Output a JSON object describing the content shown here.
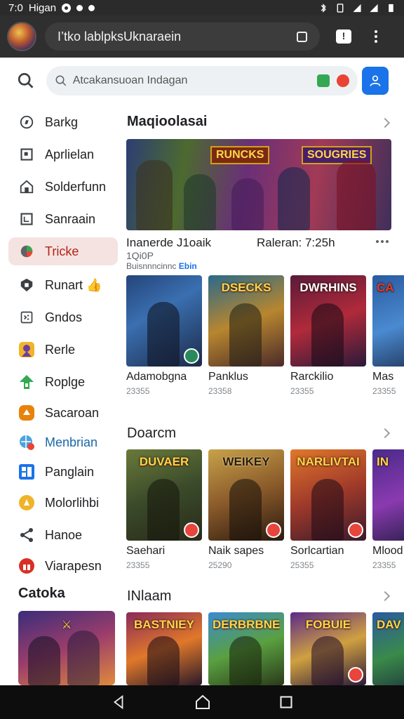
{
  "status": {
    "time": "7:0",
    "carrier": "Higan"
  },
  "browser": {
    "url": "I’tko lablpksUknaraein"
  },
  "search": {
    "placeholder": "Atcakansuoan Indagan"
  },
  "sidebar": {
    "items": [
      {
        "label": "Barkg",
        "icon": "explore-icon"
      },
      {
        "label": "Aprlielan",
        "icon": "square-app-icon"
      },
      {
        "label": "Solderfunn",
        "icon": "home-icon"
      },
      {
        "label": "Sanraain",
        "icon": "window-icon"
      },
      {
        "label": "Tricke",
        "icon": "game-ball-icon",
        "active": true
      },
      {
        "label": "Runart 👍",
        "icon": "shield-gift-icon"
      },
      {
        "label": "Gndos",
        "icon": "calendar-icon"
      },
      {
        "label": "Rerle",
        "icon": "character-icon"
      },
      {
        "label": "Roplge",
        "icon": "upload-icon"
      },
      {
        "label": "Sacaroan",
        "icon": "badge-icon"
      },
      {
        "label": "Menbrian",
        "icon": "globe-icon"
      },
      {
        "label": "Panglain",
        "icon": "dashboard-icon"
      },
      {
        "label": "Molorlihbi",
        "icon": "medal-icon"
      },
      {
        "label": "Hanoe",
        "icon": "share-icon"
      },
      {
        "label": "Viarapesn",
        "icon": "gift-icon"
      }
    ],
    "section_title": "Catoka"
  },
  "main": {
    "section1": {
      "title": "Maqioolasai",
      "banner_logo1": "RUNCKS",
      "banner_logo2": "SOUGRIES",
      "banner_title": "Inanerde J1oaik",
      "banner_sub": "1Qi0P",
      "banner_caption": "Buisnnncinnc",
      "banner_caption_link": "Ebin",
      "banner_right": "Raleran: 7:25h"
    },
    "row1": [
      {
        "name": "Adamobgna",
        "meta": "23355",
        "logo": ""
      },
      {
        "name": "Panklus",
        "meta": "23358",
        "logo": "DSECKS"
      },
      {
        "name": "Rarckilio",
        "meta": "23355",
        "logo": "DWRHINS"
      },
      {
        "name": "Mas",
        "meta": "23355",
        "logo": "CA"
      }
    ],
    "section2": {
      "title": "Doarcm"
    },
    "row2": [
      {
        "name": "Saehari",
        "meta": "23355",
        "logo": "DUVAER"
      },
      {
        "name": "Naik sapes",
        "meta": "25290",
        "logo": "WEIKEY"
      },
      {
        "name": "Sorlcartian",
        "meta": "25355",
        "logo": "NARLIVTAI"
      },
      {
        "name": "Mlood",
        "meta": "23355",
        "logo": "IN"
      }
    ],
    "section3": {
      "title": "INlaam"
    },
    "row3": [
      {
        "logo": "BASTNIEY"
      },
      {
        "logo": "DERBRBNE"
      },
      {
        "logo": "FOBUIE"
      },
      {
        "logo": "DAV"
      }
    ]
  },
  "colors": {
    "accent": "#1a73e8",
    "active_bg": "#f4e3e1",
    "active_text": "#b42318"
  }
}
